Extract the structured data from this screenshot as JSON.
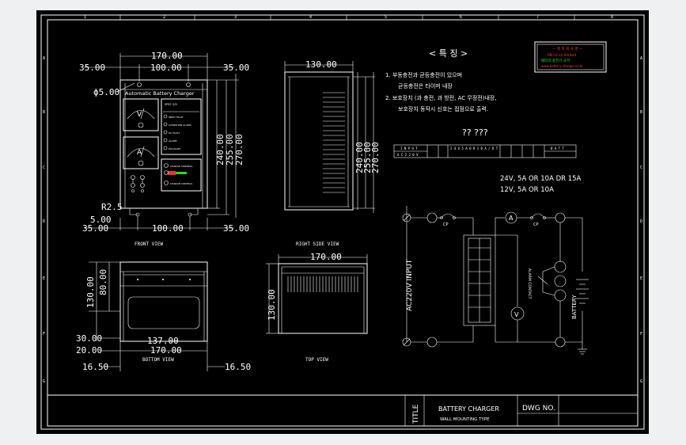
{
  "sheet": {
    "border_ticks": {
      "top": [
        "1",
        "2",
        "3",
        "4",
        "5",
        "6",
        "7",
        "8"
      ],
      "sides": [
        "A",
        "B",
        "C",
        "D",
        "E",
        "F",
        "G"
      ]
    },
    "features": {
      "title": "< 특 징 >",
      "line1a": "1. 부동충전과 균등충전이 있으며",
      "line1b": "균등충전은 타이머 내장",
      "line2a": "2. 보호장치 (과 충전, 과 방전, AC 무정전)내장,",
      "line2b": "보호장치 동작시 신호는 접점으로 출력."
    },
    "qmark_heading": "?? ???",
    "spec_table": {
      "left_top": "I N P U T",
      "left_bottom": "A C  2 2 0 V",
      "mid": "2 4 V  5 A  O R  1 0 A / D T",
      "right": "B A T T"
    },
    "ratings": {
      "line1": "24V, 5A OR 10A DR 15A",
      "line2": "12V, 5A OR 10A"
    },
    "logo": {
      "line1": "— 제 목 회 사 명 —",
      "line2": "PB cd  co,limited",
      "line3": "배터리 충전기 규격",
      "line4": "www.battery-charger.co.kr"
    },
    "front": {
      "dims": {
        "top_width": "170.00",
        "inner_width": "100.00",
        "left_off": "35.00",
        "right_off": "35.00",
        "hole": "ϕ5.00",
        "h1": "240.00",
        "h2": "255.00",
        "h3": "270.00",
        "radius": "R2.5",
        "bottom_gap": "5.00",
        "bot_left": "35.00",
        "bot_inner": "100.00",
        "bot_right": "35.00"
      },
      "panel_title": "Automatic  Battery  Charger",
      "meter_v": "V",
      "meter_a": "A",
      "leds": [
        "INPUT FAULT",
        "CONDITION ALARM",
        "DC FAULT",
        "ALARM",
        "EQUALIZE"
      ],
      "spec_label": "SPEC  5/5",
      "switch_labels": [
        "CHARGE CONTROL",
        "CHARGE CONTROL"
      ],
      "view_label": "FRONT VIEW"
    },
    "right_side": {
      "dims": {
        "depth": "130.00",
        "h1": "240.00",
        "h2": "255.00",
        "h3": "270.00"
      },
      "view_label": "RIGHT SIDE VIEW"
    },
    "bottom": {
      "dims": {
        "h130": "130.00",
        "h80": "80.00",
        "d30": "30.00",
        "d20": "20.00",
        "w137": "137.00",
        "w170": "170.00",
        "off_left": "16.50",
        "off_right": "16.50"
      },
      "view_label": "BOTTOM VIEW"
    },
    "top": {
      "dims": {
        "width": "170.00",
        "depth": "130.00"
      },
      "view_label": "TOP VIEW"
    },
    "schematic": {
      "input_label": "AC220V  INPUT",
      "cp1": "CP",
      "cp2": "CP",
      "meter_a": "A",
      "meter_v": "V",
      "alarm": "ALARM CONTACT",
      "battery": "BATTERY"
    },
    "title_block": {
      "title_label": "TITLE",
      "title_line1": "BATTERY CHARGER",
      "title_line2": "WALL MOUNTING TYPE",
      "dwg_label": "DWG NO."
    }
  }
}
